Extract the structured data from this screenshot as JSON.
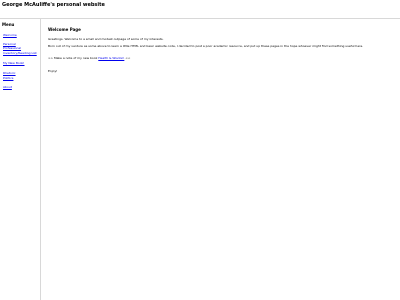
{
  "header": {
    "title": "George McAuliffe's personal website"
  },
  "sidebar": {
    "heading": "Menu",
    "items": [
      {
        "label": "Welcome"
      },
      {
        "label": "Personal"
      },
      {
        "label": "Professional"
      },
      {
        "label": "Inventory/Reading List"
      },
      {
        "label": "My New Book!"
      },
      {
        "label": "Rhetoric"
      },
      {
        "label": "Politics"
      },
      {
        "label": "About"
      }
    ]
  },
  "main": {
    "heading": "Welcome Page",
    "greeting": "Greetings. Welcome to a small and modest outpage of some of my interests.",
    "intro": "Born out of my venture as some above to learn a little HTML and basic website code, I decided to post a poor academic resource, and put up these pages in the hope whoever might find something useful here.",
    "contact_prefix": ">> Make a note of my new book",
    "contact_link": "Health & Wisdom",
    "contact_suffix": "<<",
    "signoff": "Enjoy!"
  }
}
